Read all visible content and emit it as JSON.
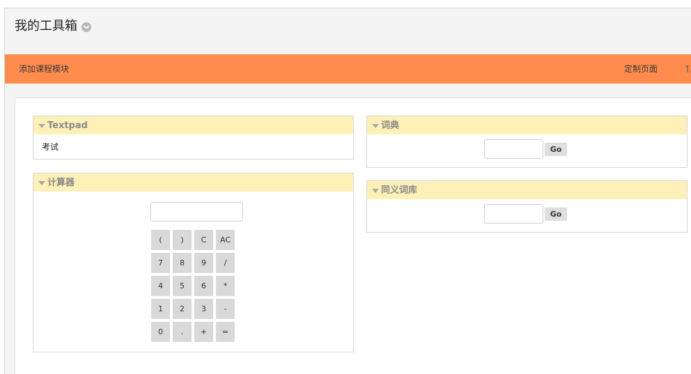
{
  "page": {
    "title": "我的工具箱"
  },
  "toolbar": {
    "add_module": "添加课程模块",
    "customize_page": "定制页面"
  },
  "modules": {
    "textpad": {
      "title": "Textpad",
      "content": "考试"
    },
    "calculator": {
      "title": "计算器",
      "display_value": "",
      "keys": [
        "(",
        ")",
        "C",
        "AC",
        "7",
        "8",
        "9",
        "/",
        "4",
        "5",
        "6",
        "*",
        "1",
        "2",
        "3",
        "-",
        "0",
        ".",
        "+",
        "="
      ]
    },
    "dictionary": {
      "title": "词典",
      "input_value": "",
      "go_label": "Go"
    },
    "thesaurus": {
      "title": "同义词库",
      "input_value": "",
      "go_label": "Go"
    }
  },
  "colors": {
    "toolbar": "#ff8c4c",
    "module_header": "#fff0b8",
    "module_title": "#8a8a8a",
    "calc_key": "#d9d9d9",
    "go_button": "#dedede"
  }
}
